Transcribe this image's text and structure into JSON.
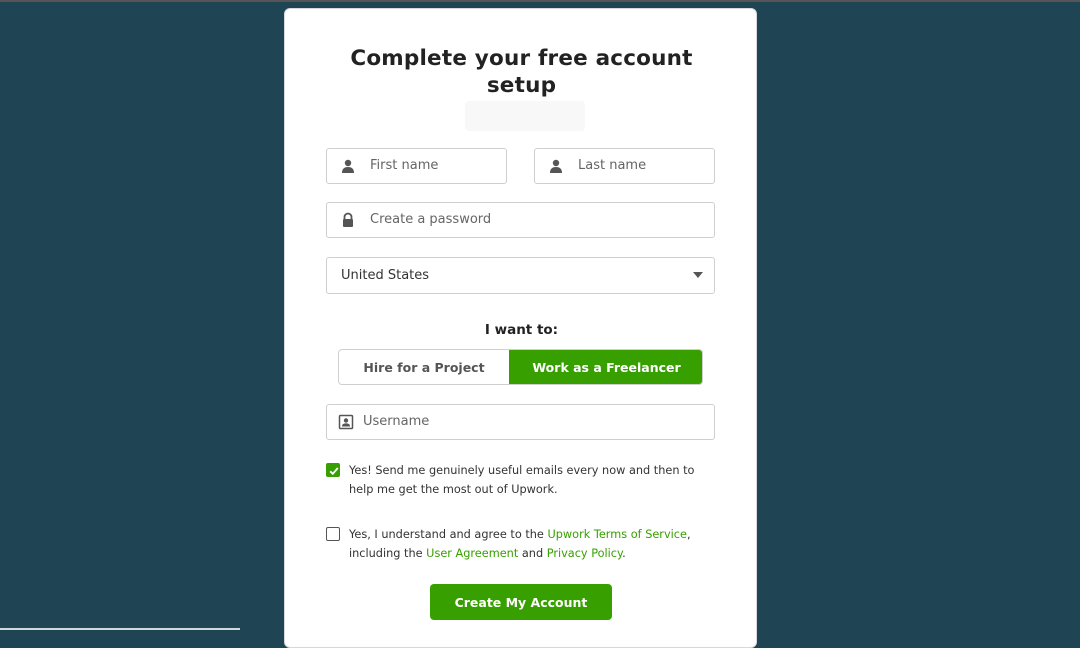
{
  "form": {
    "title": "Complete your free account setup",
    "first_name_placeholder": "First name",
    "last_name_placeholder": "Last name",
    "password_placeholder": "Create a password",
    "country_value": "United States",
    "want_label": "I want to:",
    "option_hire": "Hire for a Project",
    "option_work": "Work as a Freelancer",
    "selected_option": "Work as a Freelancer",
    "username_placeholder": "Username",
    "emails_checked": true,
    "emails_text": "Yes! Send me genuinely useful emails every now and then to help me get the most out of Upwork.",
    "terms_checked": false,
    "terms_prefix": "Yes, I understand and agree to the ",
    "terms_link": "Upwork Terms of Service",
    "terms_middle": ", including the ",
    "agreement_link": "User Agreement",
    "and_text": " and ",
    "privacy_link": "Privacy Policy",
    "terms_end": ".",
    "submit_label": "Create My Account"
  },
  "icons": {
    "first_name": "user-icon",
    "last_name": "user-icon",
    "password": "lock-icon",
    "username": "id-card-icon",
    "country_caret": "caret-down-icon",
    "emails_check": "checkmark-icon"
  },
  "colors": {
    "background": "#1f4454",
    "accent": "#37a000",
    "card": "#ffffff"
  }
}
